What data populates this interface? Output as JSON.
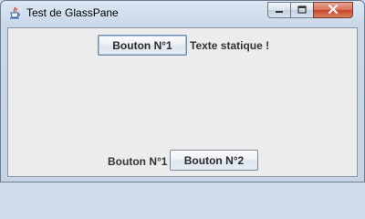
{
  "window": {
    "title": "Test de GlassPane"
  },
  "icons": {
    "app": "java-icon",
    "minimize": "minimize-icon",
    "maximize": "maximize-icon",
    "close": "close-icon"
  },
  "content": {
    "button_top": "Bouton N°1",
    "static_text": "Texte statique !",
    "bottom_label": "Bouton N°1",
    "button_bottom": "Bouton N°2"
  },
  "colors": {
    "close_button": "#c6432a",
    "content_background": "#ececec"
  }
}
